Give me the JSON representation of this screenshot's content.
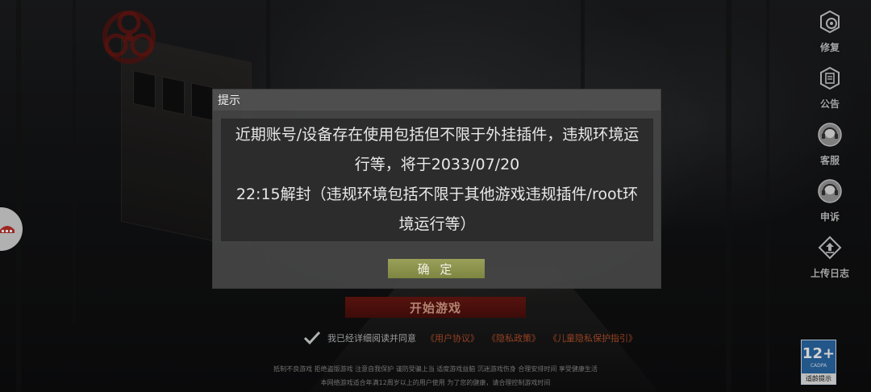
{
  "dialog": {
    "title": "提示",
    "message_line1": "近期账号/设备存在使用包括但不限于外挂插件，违规环境运",
    "message_line2": "行等，将于2033/07/20",
    "message_line3": "22:15解封（违规环境包括不限于其他游戏违规插件/root环",
    "message_line4": "境运行等）",
    "confirm_label": "确 定"
  },
  "sidebar": {
    "items": [
      {
        "label": "修复",
        "icon": "gear-icon"
      },
      {
        "label": "公告",
        "icon": "notice-icon"
      },
      {
        "label": "客服",
        "icon": "headset-icon"
      },
      {
        "label": "申诉",
        "icon": "appeal-icon"
      },
      {
        "label": "上传日志",
        "icon": "upload-icon"
      }
    ]
  },
  "start_button": {
    "label": "开始游戏"
  },
  "agreement": {
    "text": "我已经详细阅读并同意",
    "links": [
      "《用户协议》",
      "《隐私政策》",
      "《儿童隐私保护指引》"
    ]
  },
  "footer": {
    "line1": "抵制不良游戏  拒绝盗版游戏  注意自我保护  谨防受骗上当  适度游戏益脑  沉迷游戏伤身  合理安排时间  享受健康生活",
    "line2": "本网络游戏适合年满12周岁以上的用户使用    为了您的健康，请合理控制游戏时间"
  },
  "age_rating": {
    "number": "12+",
    "org": "CADPA",
    "caption": "适龄提示"
  },
  "colors": {
    "dialog_bg": "#464646",
    "confirm_bg": "#8a9050",
    "link": "#b8502a",
    "start_bg": "#5a130f"
  }
}
